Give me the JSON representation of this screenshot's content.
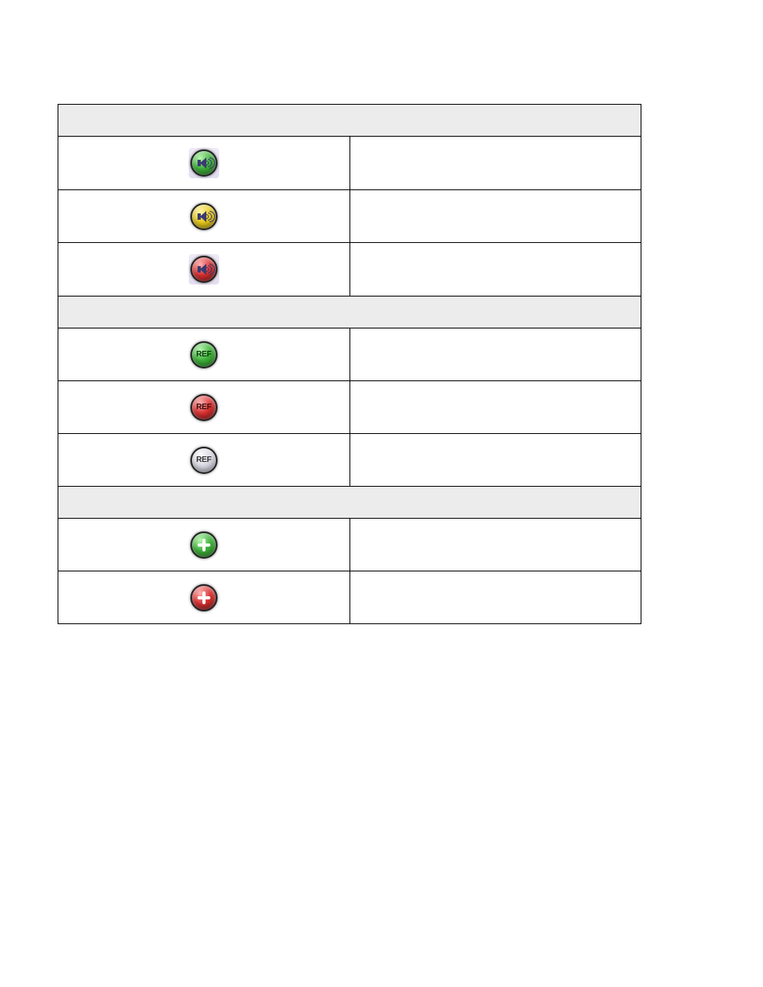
{
  "sections": [
    {
      "header": ""
    },
    {
      "icon": "speaker-green",
      "desc": ""
    },
    {
      "icon": "speaker-yellow",
      "desc": ""
    },
    {
      "icon": "speaker-red",
      "desc": ""
    },
    {
      "header": ""
    },
    {
      "icon": "ref-green",
      "desc": ""
    },
    {
      "icon": "ref-red",
      "desc": ""
    },
    {
      "icon": "ref-grey",
      "desc": ""
    },
    {
      "header": ""
    },
    {
      "icon": "cross-green",
      "desc": ""
    },
    {
      "icon": "cross-red",
      "desc": ""
    }
  ],
  "ref_label": "REF"
}
